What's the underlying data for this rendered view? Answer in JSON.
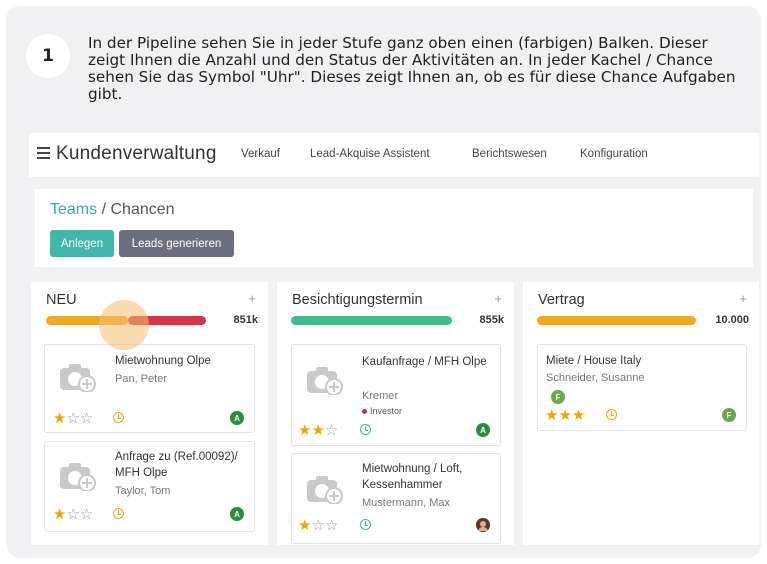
{
  "step": {
    "number": "1",
    "text": "In der Pipeline sehen Sie in jeder Stufe ganz oben einen (farbigen) Balken. Dieser zeigt Ihnen die Anzahl und den Status der Aktivitäten an. In jeder Kachel / Chance sehen Sie das Symbol \"Uhr\". Dieses zeigt Ihnen an, ob es für diese Chance Aufgaben gibt."
  },
  "app": {
    "title": "Kundenverwaltung",
    "nav": [
      "Verkauf",
      "Lead-Akquise Assistent",
      "Berichtswesen",
      "Konfiguration"
    ]
  },
  "breadcrumb": {
    "parent": "Teams",
    "separator": "/",
    "current": "Chancen"
  },
  "actions": {
    "create": "Anlegen",
    "generate_leads": "Leads generieren"
  },
  "colors": {
    "accent": "#3fb8ab",
    "bar_orange": "#f4a81d",
    "bar_red": "#d9324a",
    "bar_green": "#3cbf8c",
    "star": "#f0a500",
    "avatar_green": "#2e8b3e",
    "avatar_light_green": "#6aa84f"
  },
  "columns": [
    {
      "title": "NEU",
      "amount": "851k",
      "add_icon": "plus-icon",
      "cards": [
        {
          "title": "Mietwohnung Olpe",
          "contact": "Pan, Peter",
          "rating": 1,
          "avatar": "A"
        },
        {
          "title": "Anfrage zu (Ref.00092)/ MFH Olpe",
          "contact": "Taylor, Tom",
          "rating": 1,
          "avatar": "A"
        }
      ]
    },
    {
      "title": "Besichtigungstermin",
      "amount": "855k",
      "add_icon": "plus-icon",
      "cards": [
        {
          "title": "Kaufanfrage / MFH Olpe",
          "contact": "Kremer",
          "tag": "Investor",
          "rating": 2,
          "avatar": "A"
        },
        {
          "title": "Mietwohnung / Loft, Kessenhammer",
          "contact": "Mustermann, Max",
          "rating": 1,
          "avatar": ""
        }
      ]
    },
    {
      "title": "Vertrag",
      "amount": "10.000",
      "add_icon": "plus-icon",
      "cards": [
        {
          "title": "Miete / House Italy",
          "contact": "Schneider, Susanne",
          "rating": 3,
          "avatar": "F",
          "badge": "F"
        }
      ]
    }
  ]
}
